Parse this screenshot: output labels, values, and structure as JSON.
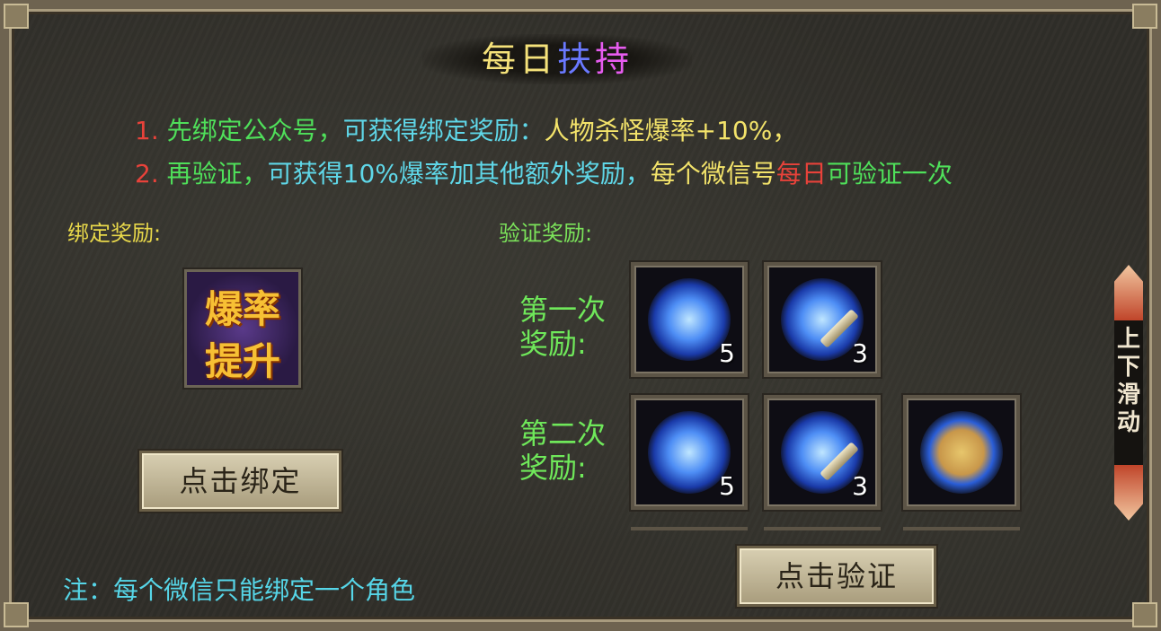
{
  "title": {
    "part1": "每日",
    "part2": "扶",
    "part3": "持"
  },
  "lines": {
    "line1": {
      "num": "1.",
      "a": "先绑定公众号，",
      "b": "可获得绑定奖励：",
      "c": "人物杀怪爆率+10%，"
    },
    "line2": {
      "num": "2.",
      "a": "再验证，",
      "b": "可获得10%爆率加其他额外奖励，",
      "c": "每个微信号",
      "d": "每日",
      "e": "可验证一次"
    }
  },
  "bind_reward": {
    "label": "绑定奖励:",
    "icon_text_1": "爆率",
    "icon_text_2": "提升",
    "button": "点击绑定"
  },
  "verify_reward": {
    "label": "验证奖励:",
    "tiers": [
      {
        "label_line1": "第一次",
        "label_line2": "奖励:",
        "items": [
          {
            "icon": "blue-orb-icon",
            "count": "5"
          },
          {
            "icon": "telescope-icon",
            "count": "3"
          }
        ]
      },
      {
        "label_line1": "第二次",
        "label_line2": "奖励:",
        "items": [
          {
            "icon": "blue-orb-icon",
            "count": "5"
          },
          {
            "icon": "telescope-icon",
            "count": "3"
          },
          {
            "icon": "golden-orb-icon",
            "count": ""
          }
        ]
      }
    ],
    "button": "点击验证"
  },
  "note": "注：每个微信只能绑定一个角色",
  "scroll_hint": {
    "text": "上下滑动"
  },
  "colors": {
    "red": "#e8423a",
    "green": "#4fe05a",
    "cyan": "#5fd7e8",
    "yellow": "#f3e36a"
  }
}
